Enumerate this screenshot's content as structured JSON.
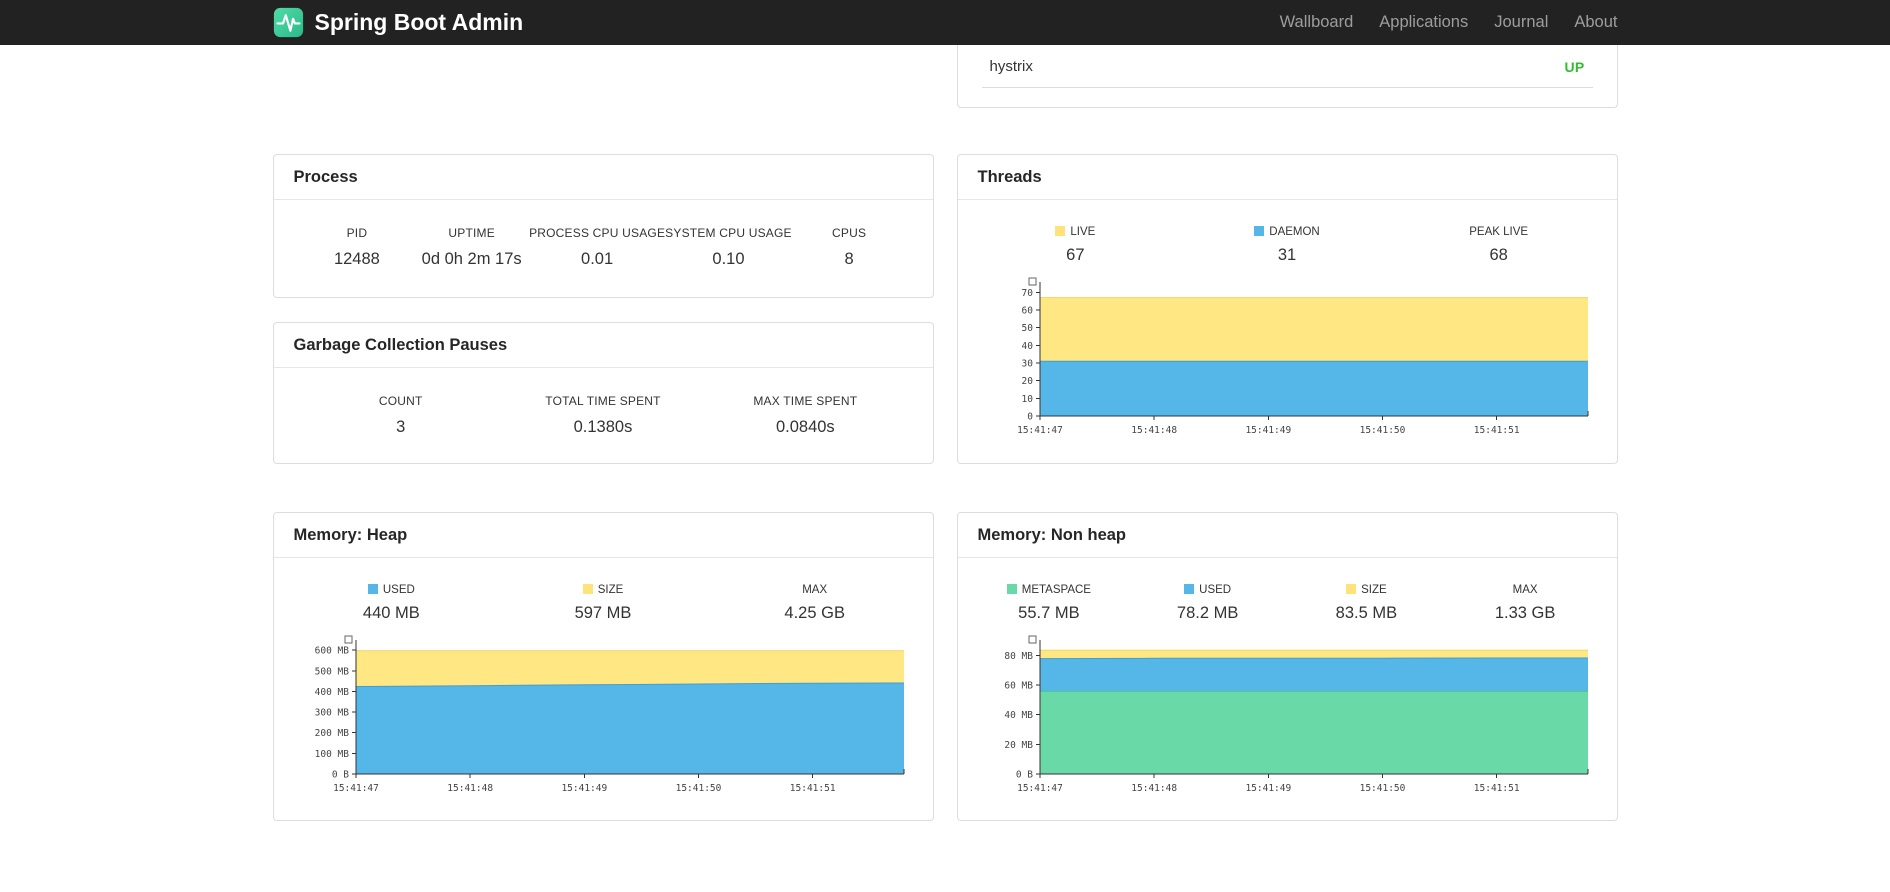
{
  "navbar": {
    "brand": "Spring Boot Admin",
    "items": [
      {
        "label": "Wallboard"
      },
      {
        "label": "Applications"
      },
      {
        "label": "Journal"
      },
      {
        "label": "About"
      }
    ]
  },
  "checks_panel": {
    "application": "hystrix",
    "status": "UP",
    "status_color": "#2fbe2f"
  },
  "process_panel": {
    "title": "Process",
    "metrics": [
      {
        "label": "PID",
        "value": "12488"
      },
      {
        "label": "UPTIME",
        "value": "0d 0h 2m 17s"
      },
      {
        "label": "PROCESS CPU USAGE",
        "value": "0.01"
      },
      {
        "label": "SYSTEM CPU USAGE",
        "value": "0.10"
      },
      {
        "label": "CPUS",
        "value": "8"
      }
    ]
  },
  "gc_panel": {
    "title": "Garbage Collection Pauses",
    "metrics": [
      {
        "label": "COUNT",
        "value": "3"
      },
      {
        "label": "TOTAL TIME SPENT",
        "value": "0.1380s"
      },
      {
        "label": "MAX TIME SPENT",
        "value": "0.0840s"
      }
    ]
  },
  "threads_panel": {
    "title": "Threads",
    "legend": [
      {
        "label": "LIVE",
        "value": "67",
        "swatch": "#ffe27a"
      },
      {
        "label": "DAEMON",
        "value": "31",
        "swatch": "#55b6e8"
      },
      {
        "label": "PEAK LIVE",
        "value": "68"
      }
    ]
  },
  "heap_panel": {
    "title": "Memory: Heap",
    "legend": [
      {
        "label": "USED",
        "value": "440 MB",
        "swatch": "#55b6e8"
      },
      {
        "label": "SIZE",
        "value": "597 MB",
        "swatch": "#ffe27a"
      },
      {
        "label": "MAX",
        "value": "4.25 GB"
      }
    ]
  },
  "nonheap_panel": {
    "title": "Memory: Non heap",
    "legend": [
      {
        "label": "METASPACE",
        "value": "55.7 MB",
        "swatch": "#69d9a8"
      },
      {
        "label": "USED",
        "value": "78.2 MB",
        "swatch": "#55b6e8"
      },
      {
        "label": "SIZE",
        "value": "83.5 MB",
        "swatch": "#ffe27a"
      },
      {
        "label": "MAX",
        "value": "1.33 GB"
      }
    ]
  },
  "chart_data": [
    {
      "id": "threads",
      "type": "area",
      "stacked_visual": "layered-areas",
      "x_labels": [
        "15:41:47",
        "15:41:48",
        "15:41:49",
        "15:41:50",
        "15:41:51"
      ],
      "series": [
        {
          "name": "LIVE",
          "color": "#ffe784",
          "line": "#f3d65a",
          "values": [
            67,
            67,
            67,
            67,
            67,
            67
          ]
        },
        {
          "name": "DAEMON",
          "color": "#55b6e8",
          "line": "#3e9fd6",
          "values": [
            31,
            31,
            31,
            31,
            31,
            31
          ]
        }
      ],
      "ylim": [
        0,
        73
      ],
      "yticks": [
        {
          "v": 0,
          "label": "0"
        },
        {
          "v": 10,
          "label": "10"
        },
        {
          "v": 20,
          "label": "20"
        },
        {
          "v": 30,
          "label": "30"
        },
        {
          "v": 40,
          "label": "40"
        },
        {
          "v": 50,
          "label": "50"
        },
        {
          "v": 60,
          "label": "60"
        },
        {
          "v": 70,
          "label": "70"
        }
      ],
      "legend_position": "top",
      "grid": false
    },
    {
      "id": "memory-heap",
      "type": "area",
      "stacked_visual": "layered-areas",
      "x_labels": [
        "15:41:47",
        "15:41:48",
        "15:41:49",
        "15:41:50",
        "15:41:51"
      ],
      "series": [
        {
          "name": "SIZE",
          "color": "#ffe784",
          "line": "#f3d65a",
          "values": [
            597,
            597,
            597,
            597,
            597,
            597
          ]
        },
        {
          "name": "USED",
          "color": "#55b6e8",
          "line": "#3e9fd6",
          "values": [
            424,
            428,
            432,
            436,
            440,
            441
          ]
        }
      ],
      "ylim": [
        0,
        625
      ],
      "yticks": [
        {
          "v": 0,
          "label": "0 B"
        },
        {
          "v": 100,
          "label": "100 MB"
        },
        {
          "v": 200,
          "label": "200 MB"
        },
        {
          "v": 300,
          "label": "300 MB"
        },
        {
          "v": 400,
          "label": "400 MB"
        },
        {
          "v": 500,
          "label": "500 MB"
        },
        {
          "v": 600,
          "label": "600 MB"
        }
      ],
      "legend_position": "top",
      "grid": false
    },
    {
      "id": "memory-nonheap",
      "type": "area",
      "stacked_visual": "layered-areas",
      "x_labels": [
        "15:41:47",
        "15:41:48",
        "15:41:49",
        "15:41:50",
        "15:41:51"
      ],
      "series": [
        {
          "name": "SIZE",
          "color": "#ffe784",
          "line": "#f3d65a",
          "values": [
            83.5,
            83.5,
            83.5,
            83.5,
            83.5,
            83.5
          ]
        },
        {
          "name": "USED",
          "color": "#55b6e8",
          "line": "#3e9fd6",
          "values": [
            77.8,
            78.0,
            78.0,
            78.1,
            78.2,
            78.2
          ]
        },
        {
          "name": "METASPACE",
          "color": "#69d9a8",
          "line": "#4fc492",
          "values": [
            55.7,
            55.7,
            55.7,
            55.7,
            55.7,
            55.7
          ]
        }
      ],
      "ylim": [
        0,
        87
      ],
      "yticks": [
        {
          "v": 0,
          "label": "0 B"
        },
        {
          "v": 20,
          "label": "20 MB"
        },
        {
          "v": 40,
          "label": "40 MB"
        },
        {
          "v": 60,
          "label": "60 MB"
        },
        {
          "v": 80,
          "label": "80 MB"
        }
      ],
      "legend_position": "top",
      "grid": false
    }
  ]
}
